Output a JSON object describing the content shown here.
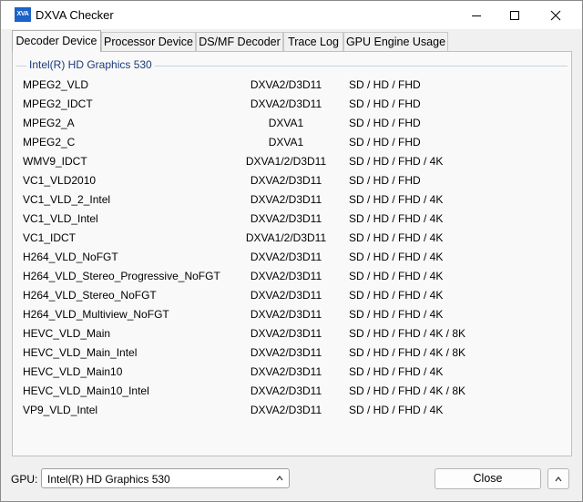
{
  "window": {
    "title": "DXVA Checker",
    "icon_text": "XVA"
  },
  "tabs": [
    {
      "label": "Decoder Device",
      "active": true
    },
    {
      "label": "Processor Device",
      "active": false
    },
    {
      "label": "DS/MF Decoder",
      "active": false
    },
    {
      "label": "Trace Log",
      "active": false
    },
    {
      "label": "GPU Engine Usage",
      "active": false
    }
  ],
  "group": {
    "label": "Intel(R) HD Graphics 530"
  },
  "decoders": [
    {
      "name": "MPEG2_VLD",
      "api": "DXVA2/D3D11",
      "res": "SD / HD / FHD"
    },
    {
      "name": "MPEG2_IDCT",
      "api": "DXVA2/D3D11",
      "res": "SD / HD / FHD"
    },
    {
      "name": "MPEG2_A",
      "api": "DXVA1",
      "res": "SD / HD / FHD"
    },
    {
      "name": "MPEG2_C",
      "api": "DXVA1",
      "res": "SD / HD / FHD"
    },
    {
      "name": "WMV9_IDCT",
      "api": "DXVA1/2/D3D11",
      "res": "SD / HD / FHD / 4K"
    },
    {
      "name": "VC1_VLD2010",
      "api": "DXVA2/D3D11",
      "res": "SD / HD / FHD"
    },
    {
      "name": "VC1_VLD_2_Intel",
      "api": "DXVA2/D3D11",
      "res": "SD / HD / FHD / 4K"
    },
    {
      "name": "VC1_VLD_Intel",
      "api": "DXVA2/D3D11",
      "res": "SD / HD / FHD / 4K"
    },
    {
      "name": "VC1_IDCT",
      "api": "DXVA1/2/D3D11",
      "res": "SD / HD / FHD / 4K"
    },
    {
      "name": "H264_VLD_NoFGT",
      "api": "DXVA2/D3D11",
      "res": "SD / HD / FHD / 4K"
    },
    {
      "name": "H264_VLD_Stereo_Progressive_NoFGT",
      "api": "DXVA2/D3D11",
      "res": "SD / HD / FHD / 4K"
    },
    {
      "name": "H264_VLD_Stereo_NoFGT",
      "api": "DXVA2/D3D11",
      "res": "SD / HD / FHD / 4K"
    },
    {
      "name": "H264_VLD_Multiview_NoFGT",
      "api": "DXVA2/D3D11",
      "res": "SD / HD / FHD / 4K"
    },
    {
      "name": "HEVC_VLD_Main",
      "api": "DXVA2/D3D11",
      "res": "SD / HD / FHD / 4K / 8K"
    },
    {
      "name": "HEVC_VLD_Main_Intel",
      "api": "DXVA2/D3D11",
      "res": "SD / HD / FHD / 4K / 8K"
    },
    {
      "name": "HEVC_VLD_Main10",
      "api": "DXVA2/D3D11",
      "res": "SD / HD / FHD / 4K"
    },
    {
      "name": "HEVC_VLD_Main10_Intel",
      "api": "DXVA2/D3D11",
      "res": "SD / HD / FHD / 4K / 8K"
    },
    {
      "name": "VP9_VLD_Intel",
      "api": "DXVA2/D3D11",
      "res": "SD / HD / FHD / 4K"
    }
  ],
  "footer": {
    "gpu_label": "GPU:",
    "gpu_value": "Intel(R) HD Graphics 530",
    "close_label": "Close"
  },
  "icons": {
    "minimize": "minimize-icon",
    "maximize": "maximize-icon",
    "close": "close-icon",
    "dropdown": "chevron-up-icon",
    "expand": "chevron-up-icon"
  },
  "colors": {
    "app_icon": "#1b62c9",
    "group_label": "#1a3a7a"
  }
}
